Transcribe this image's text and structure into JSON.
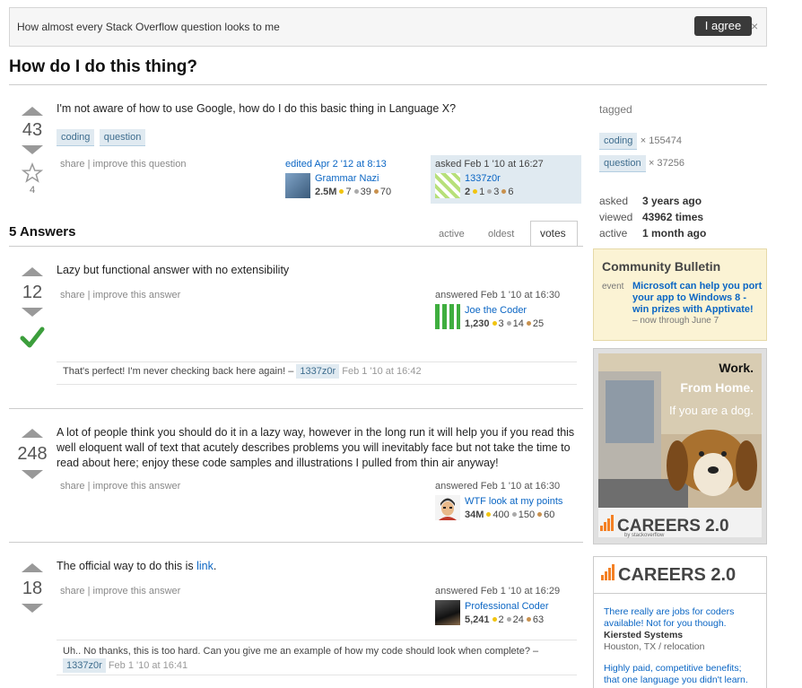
{
  "banner": {
    "text": "How almost every Stack Overflow question looks to me",
    "agree": "I agree",
    "close": "×"
  },
  "question": {
    "title": "How do I do this thing?",
    "votes": "43",
    "favorites": "4",
    "body": "I'm not aware of how to use Google, how do I do this basic thing in Language X?",
    "tags": [
      "coding",
      "question"
    ],
    "actions": {
      "share": "share",
      "improve": "improve this question"
    },
    "edited": {
      "label": "edited Apr 2 '12 at 8:13",
      "user": "Grammar Nazi",
      "rep": "2.5M",
      "gold": "7",
      "silver": "39",
      "bronze": "70"
    },
    "asked": {
      "label": "asked Feb 1 '10 at 16:27",
      "user": "1337z0r",
      "rep": "2",
      "gold": "1",
      "silver": "3",
      "bronze": "6"
    }
  },
  "answers_header": {
    "count": "5 Answers",
    "tabs": [
      "active",
      "oldest",
      "votes"
    ],
    "active_tab": "votes"
  },
  "answers": [
    {
      "votes": "12",
      "accepted": true,
      "body": "Lazy but functional answer with no extensibility",
      "actions": {
        "share": "share",
        "improve": "improve this answer"
      },
      "answered": {
        "label": "answered Feb 1 '10 at 16:30",
        "user": "Joe the Coder",
        "rep": "1,230",
        "gold": "3",
        "silver": "14",
        "bronze": "25"
      },
      "comment": {
        "text": "That's perfect! I'm never checking back here again! –",
        "user": "1337z0r",
        "time": "Feb 1 '10 at 16:42"
      }
    },
    {
      "votes": "248",
      "accepted": false,
      "body_lines": [
        "A lot of people think you should do it in a lazy way, however in the long run it will help you if you read this",
        "well eloquent wall of text that acutely describes problems you will inevitably face but not take the time to",
        "read about here; enjoy these code samples and illustrations I pulled from thin air anyway!"
      ],
      "actions": {
        "share": "share",
        "improve": "improve this answer"
      },
      "answered": {
        "label": "answered Feb 1 '10 at 16:30",
        "user": "WTF look at my points",
        "rep": "34M",
        "gold": "400",
        "silver": "150",
        "bronze": "60"
      }
    },
    {
      "votes": "18",
      "accepted": false,
      "body": "The official way to do this is",
      "link": "link",
      "period": ".",
      "actions": {
        "share": "share",
        "improve": "improve this answer"
      },
      "answered": {
        "label": "answered Feb 1 '10 at 16:29",
        "user": "Professional Coder",
        "rep": "5,241",
        "gold": "2",
        "silver": "24",
        "bronze": "63"
      },
      "comment": {
        "text": "Uh.. No thanks, this is too hard. Can you give me an example of how my code should look when complete? –",
        "user": "1337z0r",
        "time": "Feb 1 '10 at 16:41"
      }
    }
  ],
  "sidebar": {
    "tagged_label": "tagged",
    "tags": [
      {
        "name": "coding",
        "count": "× 155474"
      },
      {
        "name": "question",
        "count": "× 37256"
      }
    ],
    "stats": [
      {
        "label": "asked",
        "value": "3 years ago"
      },
      {
        "label": "viewed",
        "value": "43962 times"
      },
      {
        "label": "active",
        "value": "1 month ago"
      }
    ],
    "bulletin": {
      "title": "Community Bulletin",
      "kind": "event",
      "lines": [
        "Microsoft can help you port",
        "your app to Windows 8 -",
        "win prizes with Apptivate!"
      ],
      "sub": "– now through June 7"
    },
    "ad1": {
      "line1": "Work.",
      "line2": "From Home.",
      "line3": "If you are a dog.",
      "brand": "CAREERS 2.0",
      "by": "by stackoverflow"
    },
    "ad2": {
      "brand": "CAREERS 2.0",
      "job1_lines": [
        "There really are jobs for coders",
        "available! Not for you though."
      ],
      "company": "Kiersted Systems",
      "location": "Houston, TX / relocation",
      "job2_lines": [
        "Highly paid, competitive benefits;",
        "that one language you didn't learn."
      ]
    }
  },
  "colors": {
    "accent": "#0b66c4",
    "accept": "#3c9e3c",
    "tag_bg": "#e0eaf1",
    "bulletin_bg": "#fbf3d4"
  }
}
